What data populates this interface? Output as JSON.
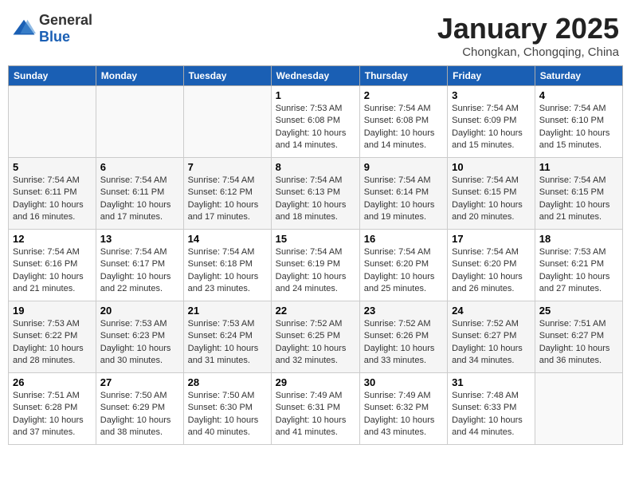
{
  "header": {
    "logo_general": "General",
    "logo_blue": "Blue",
    "month_title": "January 2025",
    "subtitle": "Chongkan, Chongqing, China"
  },
  "days_of_week": [
    "Sunday",
    "Monday",
    "Tuesday",
    "Wednesday",
    "Thursday",
    "Friday",
    "Saturday"
  ],
  "weeks": [
    [
      {
        "day": "",
        "info": ""
      },
      {
        "day": "",
        "info": ""
      },
      {
        "day": "",
        "info": ""
      },
      {
        "day": "1",
        "sunrise": "Sunrise: 7:53 AM",
        "sunset": "Sunset: 6:08 PM",
        "daylight": "Daylight: 10 hours and 14 minutes."
      },
      {
        "day": "2",
        "sunrise": "Sunrise: 7:54 AM",
        "sunset": "Sunset: 6:08 PM",
        "daylight": "Daylight: 10 hours and 14 minutes."
      },
      {
        "day": "3",
        "sunrise": "Sunrise: 7:54 AM",
        "sunset": "Sunset: 6:09 PM",
        "daylight": "Daylight: 10 hours and 15 minutes."
      },
      {
        "day": "4",
        "sunrise": "Sunrise: 7:54 AM",
        "sunset": "Sunset: 6:10 PM",
        "daylight": "Daylight: 10 hours and 15 minutes."
      }
    ],
    [
      {
        "day": "5",
        "sunrise": "Sunrise: 7:54 AM",
        "sunset": "Sunset: 6:11 PM",
        "daylight": "Daylight: 10 hours and 16 minutes."
      },
      {
        "day": "6",
        "sunrise": "Sunrise: 7:54 AM",
        "sunset": "Sunset: 6:11 PM",
        "daylight": "Daylight: 10 hours and 17 minutes."
      },
      {
        "day": "7",
        "sunrise": "Sunrise: 7:54 AM",
        "sunset": "Sunset: 6:12 PM",
        "daylight": "Daylight: 10 hours and 17 minutes."
      },
      {
        "day": "8",
        "sunrise": "Sunrise: 7:54 AM",
        "sunset": "Sunset: 6:13 PM",
        "daylight": "Daylight: 10 hours and 18 minutes."
      },
      {
        "day": "9",
        "sunrise": "Sunrise: 7:54 AM",
        "sunset": "Sunset: 6:14 PM",
        "daylight": "Daylight: 10 hours and 19 minutes."
      },
      {
        "day": "10",
        "sunrise": "Sunrise: 7:54 AM",
        "sunset": "Sunset: 6:15 PM",
        "daylight": "Daylight: 10 hours and 20 minutes."
      },
      {
        "day": "11",
        "sunrise": "Sunrise: 7:54 AM",
        "sunset": "Sunset: 6:15 PM",
        "daylight": "Daylight: 10 hours and 21 minutes."
      }
    ],
    [
      {
        "day": "12",
        "sunrise": "Sunrise: 7:54 AM",
        "sunset": "Sunset: 6:16 PM",
        "daylight": "Daylight: 10 hours and 21 minutes."
      },
      {
        "day": "13",
        "sunrise": "Sunrise: 7:54 AM",
        "sunset": "Sunset: 6:17 PM",
        "daylight": "Daylight: 10 hours and 22 minutes."
      },
      {
        "day": "14",
        "sunrise": "Sunrise: 7:54 AM",
        "sunset": "Sunset: 6:18 PM",
        "daylight": "Daylight: 10 hours and 23 minutes."
      },
      {
        "day": "15",
        "sunrise": "Sunrise: 7:54 AM",
        "sunset": "Sunset: 6:19 PM",
        "daylight": "Daylight: 10 hours and 24 minutes."
      },
      {
        "day": "16",
        "sunrise": "Sunrise: 7:54 AM",
        "sunset": "Sunset: 6:20 PM",
        "daylight": "Daylight: 10 hours and 25 minutes."
      },
      {
        "day": "17",
        "sunrise": "Sunrise: 7:54 AM",
        "sunset": "Sunset: 6:20 PM",
        "daylight": "Daylight: 10 hours and 26 minutes."
      },
      {
        "day": "18",
        "sunrise": "Sunrise: 7:53 AM",
        "sunset": "Sunset: 6:21 PM",
        "daylight": "Daylight: 10 hours and 27 minutes."
      }
    ],
    [
      {
        "day": "19",
        "sunrise": "Sunrise: 7:53 AM",
        "sunset": "Sunset: 6:22 PM",
        "daylight": "Daylight: 10 hours and 28 minutes."
      },
      {
        "day": "20",
        "sunrise": "Sunrise: 7:53 AM",
        "sunset": "Sunset: 6:23 PM",
        "daylight": "Daylight: 10 hours and 30 minutes."
      },
      {
        "day": "21",
        "sunrise": "Sunrise: 7:53 AM",
        "sunset": "Sunset: 6:24 PM",
        "daylight": "Daylight: 10 hours and 31 minutes."
      },
      {
        "day": "22",
        "sunrise": "Sunrise: 7:52 AM",
        "sunset": "Sunset: 6:25 PM",
        "daylight": "Daylight: 10 hours and 32 minutes."
      },
      {
        "day": "23",
        "sunrise": "Sunrise: 7:52 AM",
        "sunset": "Sunset: 6:26 PM",
        "daylight": "Daylight: 10 hours and 33 minutes."
      },
      {
        "day": "24",
        "sunrise": "Sunrise: 7:52 AM",
        "sunset": "Sunset: 6:27 PM",
        "daylight": "Daylight: 10 hours and 34 minutes."
      },
      {
        "day": "25",
        "sunrise": "Sunrise: 7:51 AM",
        "sunset": "Sunset: 6:27 PM",
        "daylight": "Daylight: 10 hours and 36 minutes."
      }
    ],
    [
      {
        "day": "26",
        "sunrise": "Sunrise: 7:51 AM",
        "sunset": "Sunset: 6:28 PM",
        "daylight": "Daylight: 10 hours and 37 minutes."
      },
      {
        "day": "27",
        "sunrise": "Sunrise: 7:50 AM",
        "sunset": "Sunset: 6:29 PM",
        "daylight": "Daylight: 10 hours and 38 minutes."
      },
      {
        "day": "28",
        "sunrise": "Sunrise: 7:50 AM",
        "sunset": "Sunset: 6:30 PM",
        "daylight": "Daylight: 10 hours and 40 minutes."
      },
      {
        "day": "29",
        "sunrise": "Sunrise: 7:49 AM",
        "sunset": "Sunset: 6:31 PM",
        "daylight": "Daylight: 10 hours and 41 minutes."
      },
      {
        "day": "30",
        "sunrise": "Sunrise: 7:49 AM",
        "sunset": "Sunset: 6:32 PM",
        "daylight": "Daylight: 10 hours and 43 minutes."
      },
      {
        "day": "31",
        "sunrise": "Sunrise: 7:48 AM",
        "sunset": "Sunset: 6:33 PM",
        "daylight": "Daylight: 10 hours and 44 minutes."
      },
      {
        "day": "",
        "info": ""
      }
    ]
  ]
}
